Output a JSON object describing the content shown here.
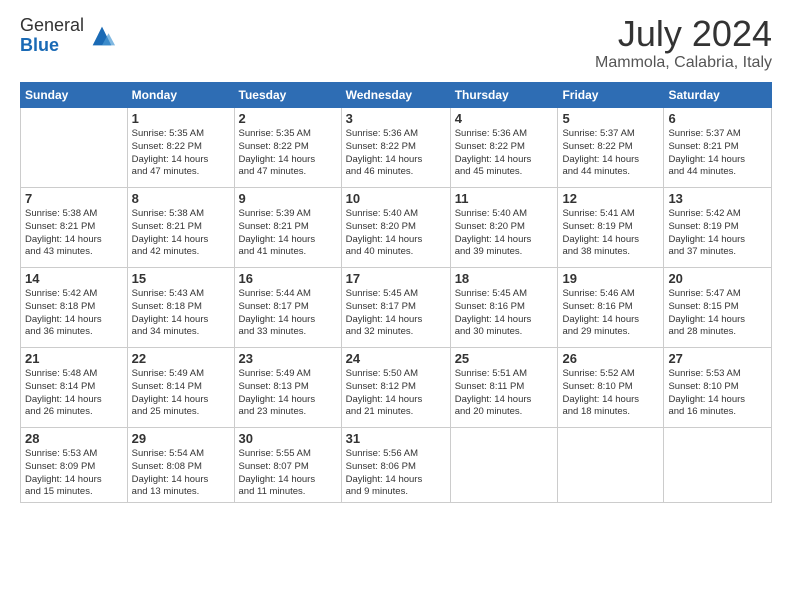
{
  "header": {
    "logo_general": "General",
    "logo_blue": "Blue",
    "title": "July 2024",
    "location": "Mammola, Calabria, Italy"
  },
  "days_of_week": [
    "Sunday",
    "Monday",
    "Tuesday",
    "Wednesday",
    "Thursday",
    "Friday",
    "Saturday"
  ],
  "weeks": [
    [
      {
        "day": "",
        "info": ""
      },
      {
        "day": "1",
        "info": "Sunrise: 5:35 AM\nSunset: 8:22 PM\nDaylight: 14 hours\nand 47 minutes."
      },
      {
        "day": "2",
        "info": "Sunrise: 5:35 AM\nSunset: 8:22 PM\nDaylight: 14 hours\nand 47 minutes."
      },
      {
        "day": "3",
        "info": "Sunrise: 5:36 AM\nSunset: 8:22 PM\nDaylight: 14 hours\nand 46 minutes."
      },
      {
        "day": "4",
        "info": "Sunrise: 5:36 AM\nSunset: 8:22 PM\nDaylight: 14 hours\nand 45 minutes."
      },
      {
        "day": "5",
        "info": "Sunrise: 5:37 AM\nSunset: 8:22 PM\nDaylight: 14 hours\nand 44 minutes."
      },
      {
        "day": "6",
        "info": "Sunrise: 5:37 AM\nSunset: 8:21 PM\nDaylight: 14 hours\nand 44 minutes."
      }
    ],
    [
      {
        "day": "7",
        "info": "Sunrise: 5:38 AM\nSunset: 8:21 PM\nDaylight: 14 hours\nand 43 minutes."
      },
      {
        "day": "8",
        "info": "Sunrise: 5:38 AM\nSunset: 8:21 PM\nDaylight: 14 hours\nand 42 minutes."
      },
      {
        "day": "9",
        "info": "Sunrise: 5:39 AM\nSunset: 8:21 PM\nDaylight: 14 hours\nand 41 minutes."
      },
      {
        "day": "10",
        "info": "Sunrise: 5:40 AM\nSunset: 8:20 PM\nDaylight: 14 hours\nand 40 minutes."
      },
      {
        "day": "11",
        "info": "Sunrise: 5:40 AM\nSunset: 8:20 PM\nDaylight: 14 hours\nand 39 minutes."
      },
      {
        "day": "12",
        "info": "Sunrise: 5:41 AM\nSunset: 8:19 PM\nDaylight: 14 hours\nand 38 minutes."
      },
      {
        "day": "13",
        "info": "Sunrise: 5:42 AM\nSunset: 8:19 PM\nDaylight: 14 hours\nand 37 minutes."
      }
    ],
    [
      {
        "day": "14",
        "info": "Sunrise: 5:42 AM\nSunset: 8:18 PM\nDaylight: 14 hours\nand 36 minutes."
      },
      {
        "day": "15",
        "info": "Sunrise: 5:43 AM\nSunset: 8:18 PM\nDaylight: 14 hours\nand 34 minutes."
      },
      {
        "day": "16",
        "info": "Sunrise: 5:44 AM\nSunset: 8:17 PM\nDaylight: 14 hours\nand 33 minutes."
      },
      {
        "day": "17",
        "info": "Sunrise: 5:45 AM\nSunset: 8:17 PM\nDaylight: 14 hours\nand 32 minutes."
      },
      {
        "day": "18",
        "info": "Sunrise: 5:45 AM\nSunset: 8:16 PM\nDaylight: 14 hours\nand 30 minutes."
      },
      {
        "day": "19",
        "info": "Sunrise: 5:46 AM\nSunset: 8:16 PM\nDaylight: 14 hours\nand 29 minutes."
      },
      {
        "day": "20",
        "info": "Sunrise: 5:47 AM\nSunset: 8:15 PM\nDaylight: 14 hours\nand 28 minutes."
      }
    ],
    [
      {
        "day": "21",
        "info": "Sunrise: 5:48 AM\nSunset: 8:14 PM\nDaylight: 14 hours\nand 26 minutes."
      },
      {
        "day": "22",
        "info": "Sunrise: 5:49 AM\nSunset: 8:14 PM\nDaylight: 14 hours\nand 25 minutes."
      },
      {
        "day": "23",
        "info": "Sunrise: 5:49 AM\nSunset: 8:13 PM\nDaylight: 14 hours\nand 23 minutes."
      },
      {
        "day": "24",
        "info": "Sunrise: 5:50 AM\nSunset: 8:12 PM\nDaylight: 14 hours\nand 21 minutes."
      },
      {
        "day": "25",
        "info": "Sunrise: 5:51 AM\nSunset: 8:11 PM\nDaylight: 14 hours\nand 20 minutes."
      },
      {
        "day": "26",
        "info": "Sunrise: 5:52 AM\nSunset: 8:10 PM\nDaylight: 14 hours\nand 18 minutes."
      },
      {
        "day": "27",
        "info": "Sunrise: 5:53 AM\nSunset: 8:10 PM\nDaylight: 14 hours\nand 16 minutes."
      }
    ],
    [
      {
        "day": "28",
        "info": "Sunrise: 5:53 AM\nSunset: 8:09 PM\nDaylight: 14 hours\nand 15 minutes."
      },
      {
        "day": "29",
        "info": "Sunrise: 5:54 AM\nSunset: 8:08 PM\nDaylight: 14 hours\nand 13 minutes."
      },
      {
        "day": "30",
        "info": "Sunrise: 5:55 AM\nSunset: 8:07 PM\nDaylight: 14 hours\nand 11 minutes."
      },
      {
        "day": "31",
        "info": "Sunrise: 5:56 AM\nSunset: 8:06 PM\nDaylight: 14 hours\nand 9 minutes."
      },
      {
        "day": "",
        "info": ""
      },
      {
        "day": "",
        "info": ""
      },
      {
        "day": "",
        "info": ""
      }
    ]
  ]
}
